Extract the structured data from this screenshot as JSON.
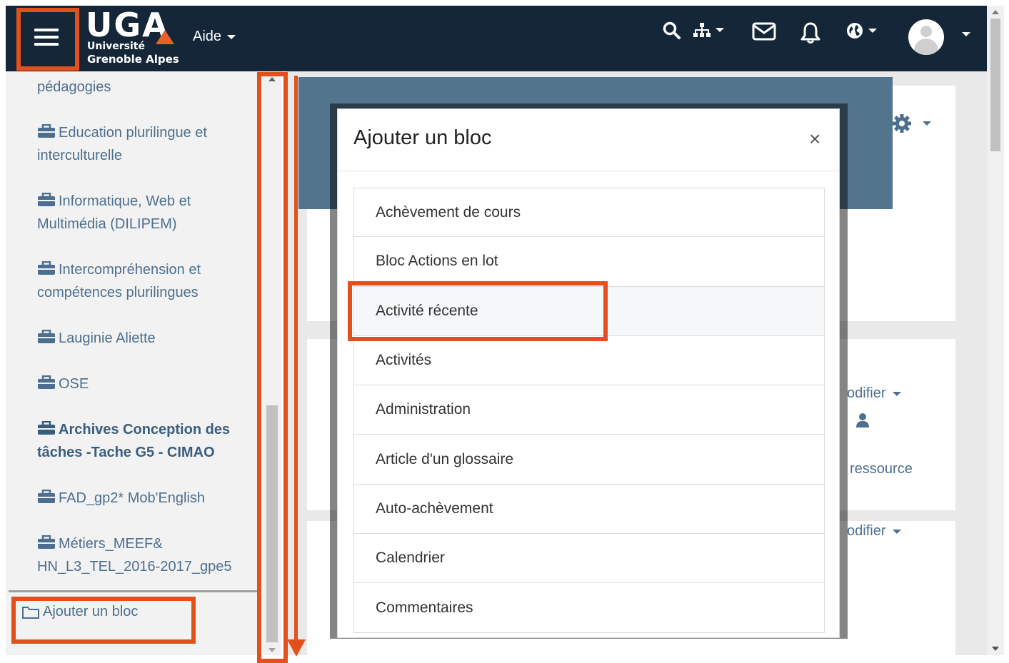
{
  "navbar": {
    "menu_icon": "hamburger-menu-icon",
    "logo": {
      "word": "UGA",
      "line1": "Université",
      "line2": "Grenoble Alpes"
    },
    "aide_label": "Aide",
    "icons": [
      "search-icon",
      "sitemap-icon",
      "envelope-icon",
      "bell-icon",
      "globe-icon",
      "user-avatar"
    ]
  },
  "drawer": {
    "items": [
      {
        "label": "pédagogies",
        "icon": ""
      },
      {
        "label": "Education plurilingue et interculturelle",
        "icon": "briefcase-icon"
      },
      {
        "label": "Informatique, Web et Multimédia (DILIPEM)",
        "icon": "briefcase-icon"
      },
      {
        "label": "Intercompréhension et compétences plurilingues",
        "icon": "briefcase-icon"
      },
      {
        "label": "Lauginie Aliette",
        "icon": "briefcase-icon"
      },
      {
        "label": "OSE",
        "icon": "briefcase-icon"
      },
      {
        "label": "Archives Conception des tâches -Tache G5 - CIMAO",
        "icon": "briefcase-icon"
      },
      {
        "label": "FAD_gp2* Mob'English",
        "icon": "briefcase-icon"
      },
      {
        "label": "Métiers_MEEF& HN_L3_TEL_2016-2017_gpe5",
        "icon": "briefcase-icon"
      }
    ],
    "add_block_label": "Ajouter un bloc",
    "add_block_icon": "folder-icon"
  },
  "background": {
    "modifier_label": "odifier",
    "ressource_label": "ressource"
  },
  "modal": {
    "title": "Ajouter un bloc",
    "close_label": "×",
    "items": [
      "Achèvement de cours",
      "Bloc Actions en lot",
      "Activité récente",
      "Activités",
      "Administration",
      "Article d'un glossaire",
      "Auto-achèvement",
      "Calendrier",
      "Commentaires"
    ],
    "highlighted_index": 2
  },
  "colors": {
    "navbar": "#142638",
    "accent": "#e4501b",
    "link": "#4d6f8f"
  }
}
